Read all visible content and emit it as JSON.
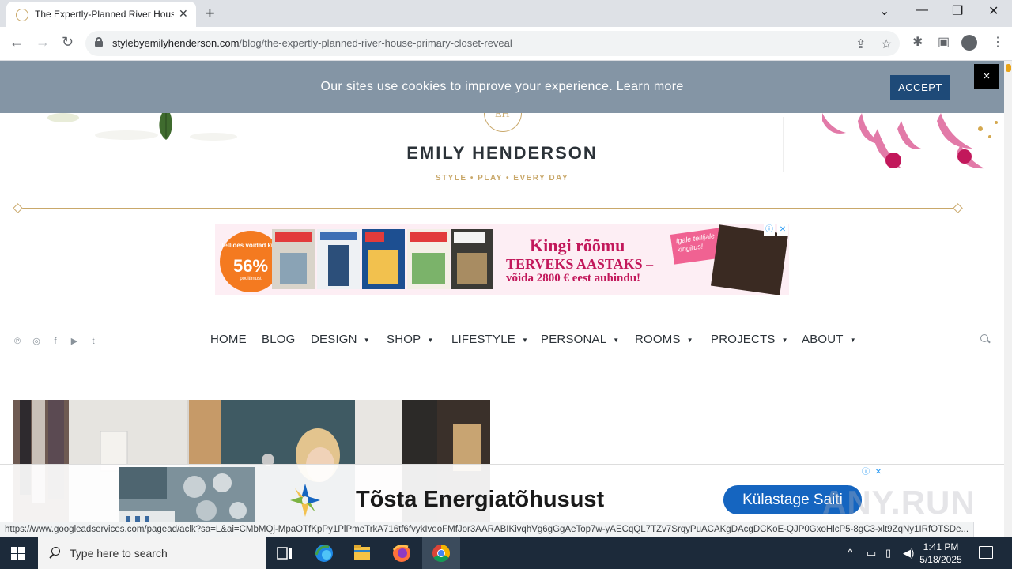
{
  "browser": {
    "tab_title": "The Expertly-Planned River House",
    "tab_close": "✕",
    "new_tab": "+",
    "url_domain": "stylebyemilyhenderson.com",
    "url_path": "/blog/the-expertly-planned-river-house-primary-closet-reveal",
    "win_chevron": "⌄",
    "win_minimize": "—",
    "win_restore": "❐",
    "win_close": "✕"
  },
  "cookie": {
    "text": "Our sites use cookies to improve your experience. Learn more",
    "accept_label": "ACCEPT",
    "close_label": "×"
  },
  "header": {
    "emblem": "EH",
    "brand": "EMILY HENDERSON",
    "tagline": "STYLE   •   PLAY   •   EVERY DAY"
  },
  "ad_top": {
    "badge_small": "Tellides võidad kuni",
    "badge_big": "56%",
    "badge_tiny": "pooltimust",
    "headline": "Kingi rõõmu",
    "sub": "TERVEKS AASTAKS –",
    "prize": "võida 2800 € eest auhindu!",
    "pink_note": "Igale tellijale kingitus!",
    "adchoice_info": "ⓘ",
    "adchoice_close": "✕"
  },
  "nav": {
    "items": [
      {
        "label": "HOME",
        "dropdown": false
      },
      {
        "label": "BLOG",
        "dropdown": false
      },
      {
        "label": "DESIGN",
        "dropdown": true
      },
      {
        "label": "SHOP",
        "dropdown": true
      },
      {
        "label": "LIFESTYLE",
        "dropdown": true
      },
      {
        "label": "PERSONAL",
        "dropdown": true
      },
      {
        "label": "ROOMS",
        "dropdown": true
      },
      {
        "label": "PROJECTS",
        "dropdown": true
      },
      {
        "label": "ABOUT",
        "dropdown": true
      }
    ],
    "dropdown_arrow": "▼",
    "social": [
      "pinterest-icon",
      "instagram-icon",
      "facebook-icon",
      "youtube-icon",
      "twitter-icon"
    ]
  },
  "ad_bottom": {
    "headline": "Tõsta Energiatõhusust",
    "cta": "Külastage Saiti"
  },
  "status_bar": {
    "url": "https://www.googleadservices.com/pagead/aclk?sa=L&ai=CMbMQj-MpaOTfKpPy1PlPmeTrkA716tf6fvykIveoFMfJor3AARABIKivqhVg6gGgAeTop7w-yAECqQL7TZv7SrqyPuACAKgDAcgDCKoE-QJP0GxoHlcP5-8gC3-xlt9ZqNy1IRfOTSDe..."
  },
  "watermark": "ANY.RUN",
  "taskbar": {
    "search_placeholder": "Type here to search",
    "time": "1:41 PM",
    "date": "5/18/2025"
  },
  "colors": {
    "gold": "#c9a86a",
    "cookie_bg": "#8495a5",
    "accept_bg": "#1e4a78",
    "taskbar_bg": "#1c2a3a"
  }
}
